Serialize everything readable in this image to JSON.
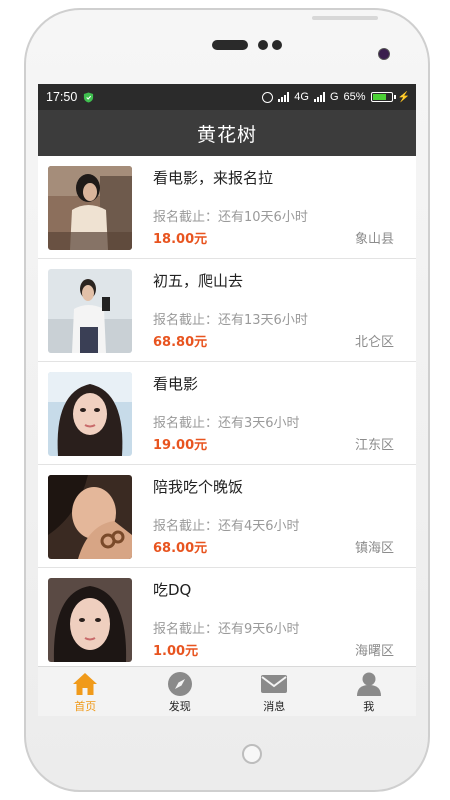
{
  "status_bar": {
    "time": "17:50",
    "network1": "4G",
    "network2": "G",
    "battery_percent": "65%",
    "battery_level": 0.65,
    "colors": {
      "shield": "#3fbf4f",
      "battery": "#4cd136"
    }
  },
  "header": {
    "title": "黄花树"
  },
  "events": [
    {
      "title": "看电影，来报名拉",
      "deadline": "报名截止：还有10天6小时",
      "price": "18.00元",
      "area": "象山县"
    },
    {
      "title": "初五，爬山去",
      "deadline": "报名截止：还有13天6小时",
      "price": "68.80元",
      "area": "北仑区"
    },
    {
      "title": "看电影",
      "deadline": "报名截止：还有3天6小时",
      "price": "19.00元",
      "area": "江东区"
    },
    {
      "title": "陪我吃个晚饭",
      "deadline": "报名截止：还有4天6小时",
      "price": "68.00元",
      "area": "镇海区"
    },
    {
      "title": "吃DQ",
      "deadline": "报名截止：还有9天6小时",
      "price": "1.00元",
      "area": "海曙区"
    }
  ],
  "tabs": [
    {
      "label": "首页",
      "icon": "home-icon",
      "active": true
    },
    {
      "label": "发现",
      "icon": "compass-icon",
      "active": false
    },
    {
      "label": "消息",
      "icon": "mail-icon",
      "active": false
    },
    {
      "label": "我",
      "icon": "user-icon",
      "active": false
    }
  ],
  "colors": {
    "accent": "#f09a1a",
    "price": "#e8541f",
    "header_bg": "#3c3c3c"
  }
}
